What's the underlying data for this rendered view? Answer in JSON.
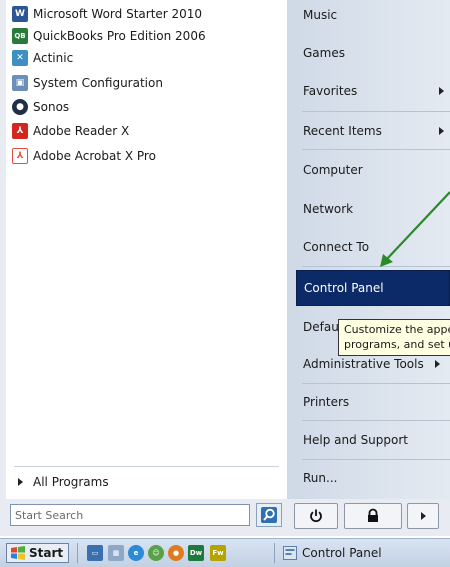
{
  "programs": [
    {
      "label": "Microsoft Word Starter 2010",
      "icon": "word-icon",
      "color": "#2b5797",
      "glyph": "W"
    },
    {
      "label": "QuickBooks Pro Edition 2006",
      "icon": "quickbooks-icon",
      "color": "#2a7a3b",
      "glyph": "QB"
    },
    {
      "label": "Actinic",
      "icon": "actinic-icon",
      "color": "#3d8fc4",
      "glyph": "✕"
    },
    {
      "label": "System Configuration",
      "icon": "system-configuration-icon",
      "color": "#6b8fb8",
      "glyph": "▣"
    },
    {
      "label": "Sonos",
      "icon": "sonos-icon",
      "color": "#1f2f45",
      "glyph": "●"
    },
    {
      "label": "Adobe Reader X",
      "icon": "adobe-reader-icon",
      "color": "#d2261e",
      "glyph": "⅄"
    },
    {
      "label": "Adobe Acrobat X Pro",
      "icon": "adobe-acrobat-icon",
      "color": "#e94e3a",
      "glyph": "⅄"
    }
  ],
  "all_programs": "All Programs",
  "right_items": [
    {
      "label": "Music",
      "arrow": false
    },
    {
      "label": "Games",
      "arrow": false
    },
    {
      "label": "Favorites",
      "arrow": true
    },
    {
      "label": "Recent Items",
      "arrow": true
    },
    {
      "label": "Computer",
      "arrow": false
    },
    {
      "label": "Network",
      "arrow": false
    },
    {
      "label": "Connect To",
      "arrow": false
    },
    {
      "label": "Control Panel",
      "arrow": false,
      "selected": true
    },
    {
      "label": "Default Programs",
      "arrow": false
    },
    {
      "label": "Administrative Tools",
      "arrow": true
    },
    {
      "label": "Printers",
      "arrow": false
    },
    {
      "label": "Help and Support",
      "arrow": false
    },
    {
      "label": "Run...",
      "arrow": false
    }
  ],
  "tooltip": {
    "line1": "Customize the appearance and functionality of your computer, add or remove",
    "line2": "programs, and set up network connections and user accounts."
  },
  "search": {
    "placeholder": "Start Search"
  },
  "power": {
    "power_icon": "power-icon",
    "lock_icon": "lock-icon",
    "options_icon": "arrow-right-icon"
  },
  "taskbar": {
    "start_label": "Start",
    "task_label": "Control Panel",
    "quicklaunch": [
      "show-desktop-icon",
      "calculator-icon",
      "internet-explorer-icon",
      "messenger-icon",
      "firefox-icon",
      "dreamweaver-icon",
      "fireworks-icon"
    ]
  },
  "colors": {
    "selected": "#0b2a67",
    "annotation_arrow": "#2a8a2a",
    "tooltip_bg": "#ffffe1"
  }
}
